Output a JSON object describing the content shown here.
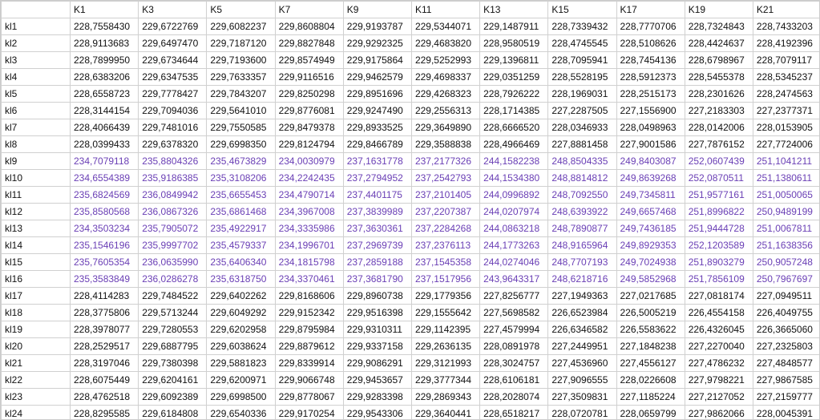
{
  "headers": [
    "K1",
    "K3",
    "K5",
    "K7",
    "K9",
    "K11",
    "K13",
    "K15",
    "K17",
    "K19",
    "K21"
  ],
  "row_labels": [
    "kl1",
    "kl2",
    "kl3",
    "kl4",
    "kl5",
    "kl6",
    "kl7",
    "kl8",
    "kl9",
    "kl10",
    "kl11",
    "kl12",
    "kl13",
    "kl14",
    "kl15",
    "kl16",
    "kl17",
    "kl18",
    "kl19",
    "kl20",
    "kl21",
    "kl22",
    "kl23",
    "kl24"
  ],
  "purple_rows": [
    "kl9",
    "kl10",
    "kl11",
    "kl12",
    "kl13",
    "kl14",
    "kl15",
    "kl16"
  ],
  "cells": {
    "kl1": [
      "228,7558430",
      "229,6722769",
      "229,6082237",
      "229,8608804",
      "229,9193787",
      "229,5344071",
      "229,1487911",
      "228,7339432",
      "228,7770706",
      "228,7324843",
      "228,7433203"
    ],
    "kl2": [
      "228,9113683",
      "229,6497470",
      "229,7187120",
      "229,8827848",
      "229,9292325",
      "229,4683820",
      "228,9580519",
      "228,4745545",
      "228,5108626",
      "228,4424637",
      "228,4192396"
    ],
    "kl3": [
      "228,7899950",
      "229,6734644",
      "229,7193600",
      "229,8574949",
      "229,9175864",
      "229,5252993",
      "229,1396811",
      "228,7095941",
      "228,7454136",
      "228,6798967",
      "228,7079117"
    ],
    "kl4": [
      "228,6383206",
      "229,6347535",
      "229,7633357",
      "229,9116516",
      "229,9462579",
      "229,4698337",
      "229,0351259",
      "228,5528195",
      "228,5912373",
      "228,5455378",
      "228,5345237"
    ],
    "kl5": [
      "228,6558723",
      "229,7778427",
      "229,7843207",
      "229,8250298",
      "229,8951696",
      "229,4268323",
      "228,7926222",
      "228,1969031",
      "228,2515173",
      "228,2301626",
      "228,2474563"
    ],
    "kl6": [
      "228,3144154",
      "229,7094036",
      "229,5641010",
      "229,8776081",
      "229,9247490",
      "229,2556313",
      "228,1714385",
      "227,2287505",
      "227,1556900",
      "227,2183303",
      "227,2377371"
    ],
    "kl7": [
      "228,4066439",
      "229,7481016",
      "229,7550585",
      "229,8479378",
      "229,8933525",
      "229,3649890",
      "228,6666520",
      "228,0346933",
      "228,0498963",
      "228,0142006",
      "228,0153905"
    ],
    "kl8": [
      "228,0399433",
      "229,6378320",
      "229,6998350",
      "229,8124794",
      "229,8466789",
      "229,3588838",
      "228,4966469",
      "227,8881458",
      "227,9001586",
      "227,7876152",
      "227,7724006"
    ],
    "kl9": [
      "234,7079118",
      "235,8804326",
      "235,4673829",
      "234,0030979",
      "237,1631778",
      "237,2177326",
      "244,1582238",
      "248,8504335",
      "249,8403087",
      "252,0607439",
      "251,1041211"
    ],
    "kl10": [
      "234,6554389",
      "235,9186385",
      "235,3108206",
      "234,2242435",
      "237,2794952",
      "237,2542793",
      "244,1534380",
      "248,8814812",
      "249,8639268",
      "252,0870511",
      "251,1380611"
    ],
    "kl11": [
      "235,6824569",
      "236,0849942",
      "235,6655453",
      "234,4790714",
      "237,4401175",
      "237,2101405",
      "244,0996892",
      "248,7092550",
      "249,7345811",
      "251,9577161",
      "251,0050065"
    ],
    "kl12": [
      "235,8580568",
      "236,0867326",
      "235,6861468",
      "234,3967008",
      "237,3839989",
      "237,2207387",
      "244,0207974",
      "248,6393922",
      "249,6657468",
      "251,8996822",
      "250,9489199"
    ],
    "kl13": [
      "234,3503234",
      "235,7905072",
      "235,4922917",
      "234,3335986",
      "237,3630361",
      "237,2284268",
      "244,0863218",
      "248,7890877",
      "249,7436185",
      "251,9444728",
      "251,0067811"
    ],
    "kl14": [
      "235,1546196",
      "235,9997702",
      "235,4579337",
      "234,1996701",
      "237,2969739",
      "237,2376113",
      "244,1773263",
      "248,9165964",
      "249,8929353",
      "252,1203589",
      "251,1638356"
    ],
    "kl15": [
      "235,7605354",
      "236,0635990",
      "235,6406340",
      "234,1815798",
      "237,2859188",
      "237,1545358",
      "244,0274046",
      "248,7707193",
      "249,7024938",
      "251,8903279",
      "250,9057248"
    ],
    "kl16": [
      "235,3583849",
      "236,0286278",
      "235,6318750",
      "234,3370461",
      "237,3681790",
      "237,1517956",
      "243,9643317",
      "248,6218716",
      "249,5852968",
      "251,7856109",
      "250,7967697"
    ],
    "kl17": [
      "228,4114283",
      "229,7484522",
      "229,6402262",
      "229,8168606",
      "229,8960738",
      "229,1779356",
      "227,8256777",
      "227,1949363",
      "227,0217685",
      "227,0818174",
      "227,0949511"
    ],
    "kl18": [
      "228,3775806",
      "229,5713244",
      "229,6049292",
      "229,9152342",
      "229,9516398",
      "229,1555642",
      "227,5698582",
      "226,6523984",
      "226,5005219",
      "226,4554158",
      "226,4049755"
    ],
    "kl19": [
      "228,3978077",
      "229,7280553",
      "229,6202958",
      "229,8795984",
      "229,9310311",
      "229,1142395",
      "227,4579994",
      "226,6346582",
      "226,5583622",
      "226,4326045",
      "226,3665060"
    ],
    "kl20": [
      "228,2529517",
      "229,6887795",
      "229,6038624",
      "229,8879612",
      "229,9337158",
      "229,2636135",
      "228,0891978",
      "227,2449951",
      "227,1848238",
      "227,2270040",
      "227,2325803"
    ],
    "kl21": [
      "228,3197046",
      "229,7380398",
      "229,5881823",
      "229,8339914",
      "229,9086291",
      "229,3121993",
      "228,3024757",
      "227,4536960",
      "227,4556127",
      "227,4786232",
      "227,4848577"
    ],
    "kl22": [
      "228,6075449",
      "229,6204161",
      "229,6200971",
      "229,9066748",
      "229,9453657",
      "229,3777344",
      "228,6106181",
      "227,9096555",
      "228,0226608",
      "227,9798221",
      "227,9867585"
    ],
    "kl23": [
      "228,4762518",
      "229,6092389",
      "229,6998500",
      "229,8778067",
      "229,9283398",
      "229,2869343",
      "228,2028074",
      "227,3509831",
      "227,1185224",
      "227,2127052",
      "227,2159777"
    ],
    "kl24": [
      "228,8295585",
      "229,6184808",
      "229,6540336",
      "229,9170254",
      "229,9543306",
      "229,3640441",
      "228,6518217",
      "228,0720781",
      "228,0659799",
      "227,9862066",
      "228,0045391"
    ]
  }
}
